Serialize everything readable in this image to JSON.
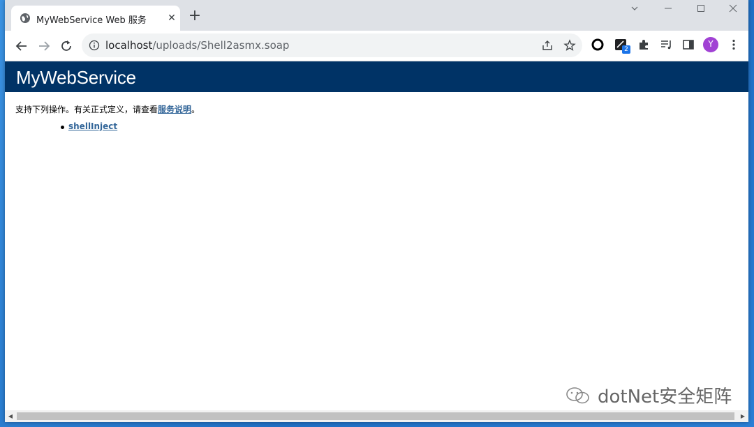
{
  "browser": {
    "tab_title": "MyWebService Web 服务",
    "url_host": "localhost",
    "url_path": "/uploads/Shell2asmx.soap",
    "new_tab_label": "+",
    "extension_badge": "2",
    "profile_initial": "Y",
    "accent_color": "#1a73e8"
  },
  "page": {
    "heading": "MyWebService",
    "heading_bg": "#003366",
    "intro_text": "支持下列操作。有关正式定义，请查看",
    "intro_link": "服务说明",
    "intro_end": "。",
    "operations": [
      "shellInject"
    ],
    "link_color": "#336699"
  },
  "watermark": {
    "text": "dotNet安全矩阵"
  }
}
